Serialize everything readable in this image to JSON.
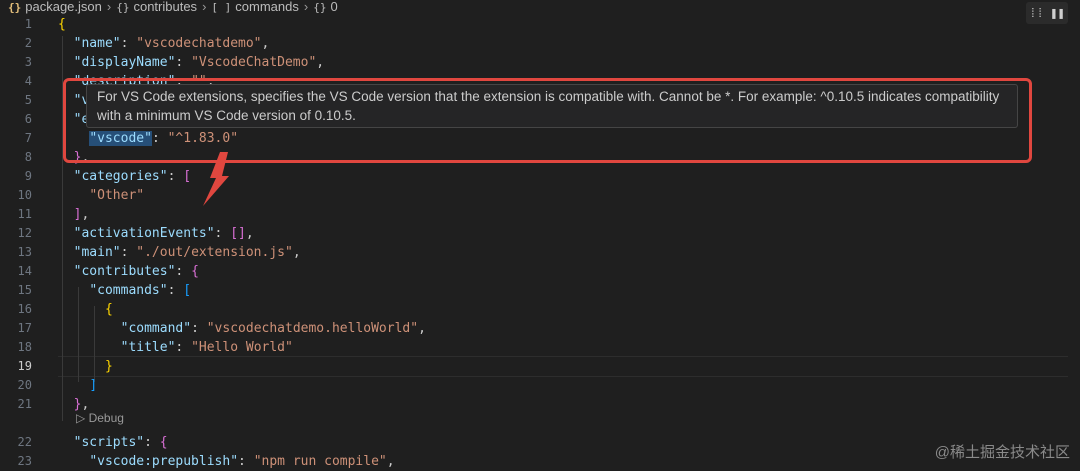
{
  "breadcrumb": {
    "file": "package.json",
    "item1": "contributes",
    "item2": "commands",
    "item3": "0"
  },
  "line_numbers": [
    "1",
    "2",
    "3",
    "4",
    "5",
    "6",
    "7",
    "8",
    "9",
    "10",
    "11",
    "12",
    "13",
    "14",
    "15",
    "16",
    "17",
    "18",
    "19",
    "20",
    "21",
    "22",
    "23"
  ],
  "active_line": "19",
  "code": {
    "name_key": "\"name\"",
    "name_val": "\"vscodechatdemo\"",
    "display_key": "\"displayName\"",
    "display_val": "\"VscodeChatDemo\"",
    "desc_key": "\"description\"",
    "desc_val": "\"\"",
    "v_key": "\"v",
    "e_key": "\"e",
    "vscode_key": "\"vscode\"",
    "vscode_val": "\"^1.83.0\"",
    "categories_key": "\"categories\"",
    "other_val": "\"Other\"",
    "activation_key": "\"activationEvents\"",
    "main_key": "\"main\"",
    "main_val": "\"./out/extension.js\"",
    "contributes_key": "\"contributes\"",
    "commands_key": "\"commands\"",
    "command_key": "\"command\"",
    "command_val": "\"vscodechatdemo.helloWorld\"",
    "title_key": "\"title\"",
    "title_val": "\"Hello World\"",
    "scripts_key": "\"scripts\"",
    "prepublish_key": "\"vscode:prepublish\"",
    "prepublish_val": "\"npm run compile\""
  },
  "codelens": "Debug",
  "hover_text": "For VS Code extensions, specifies the VS Code version that the extension is compatible with. Cannot be *. For example: ^0.10.5 indicates compatibility with a minimum VS Code version of 0.10.5.",
  "watermark": "@稀土掘金技术社区",
  "colors": {
    "annotation": "#e0473f",
    "key": "#9cdcfe",
    "string": "#ce9178"
  }
}
